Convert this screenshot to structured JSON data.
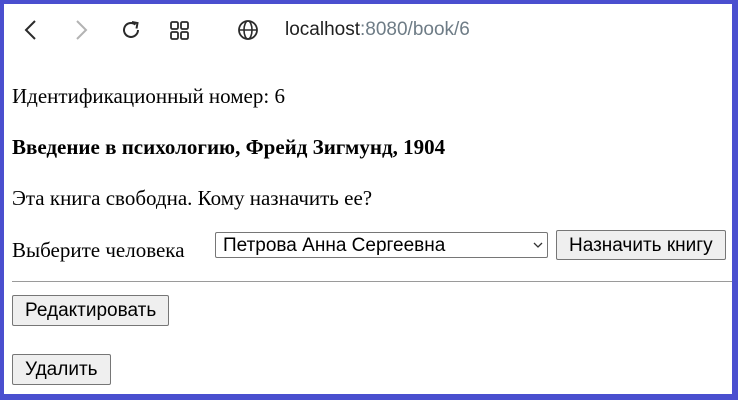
{
  "browser": {
    "url_host": "localhost",
    "url_path": ":8080/book/6"
  },
  "book": {
    "id_line": "Идентификационный номер: 6",
    "title_line": "Введение в психологию, Фрейд Зигмунд, 1904",
    "status_line": "Эта книга свободна. Кому назначить ее?"
  },
  "assign": {
    "label": "Выберите человека",
    "selected_person": "Петрова Анна Сергеевна",
    "button": "Назначить книгу"
  },
  "actions": {
    "edit_button": "Редактировать",
    "delete_button": "Удалить"
  }
}
